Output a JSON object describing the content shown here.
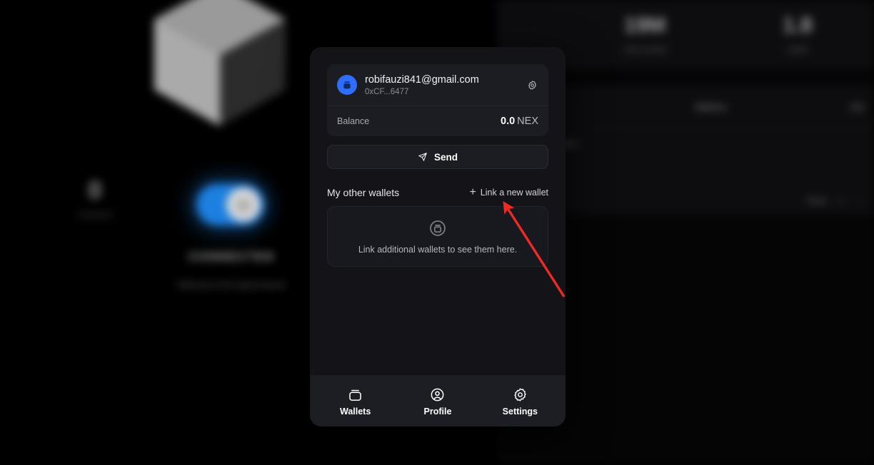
{
  "background": {
    "left": {
      "cube_icon": "cube-3d-icon",
      "counter_value": "0",
      "counter_label": "Connect",
      "toggle_state": "on",
      "toggle_icon": "power-icon",
      "connection_status": "CONNECTED",
      "connection_sub": "Welcome to the supercomputer"
    },
    "right": {
      "stats": [
        {
          "value": "·",
          "label": ""
        },
        {
          "value": "19M",
          "label": "units served"
        },
        {
          "value": "1.8",
          "label": "nodes"
        }
      ],
      "table": {
        "columns": [
          "",
          "Address",
          "Car"
        ],
        "empty_text": "Data coming soon...",
        "footer": {
          "rows_label": "Rows",
          "page": "1",
          "next": "›"
        }
      }
    }
  },
  "modal": {
    "account": {
      "avatar_icon": "wallet-avatar-icon",
      "email": "robifauzi841@gmail.com",
      "address": "0xCF...6477",
      "settings_icon": "gear-icon"
    },
    "balance": {
      "label": "Balance",
      "amount": "0.0",
      "unit": "NEX"
    },
    "send": {
      "icon": "send-paper-plane-icon",
      "label": "Send"
    },
    "other_wallets": {
      "title": "My other wallets",
      "link_new": {
        "icon": "plus-icon",
        "label": "Link a new wallet"
      },
      "empty": {
        "icon": "wallet-outline-icon",
        "text": "Link additional wallets to see them here."
      }
    },
    "nav": [
      {
        "icon": "wallet-outline-icon",
        "label": "Wallets",
        "active": true
      },
      {
        "icon": "user-circle-icon",
        "label": "Profile",
        "active": false
      },
      {
        "icon": "gear-icon",
        "label": "Settings",
        "active": false
      }
    ]
  },
  "annotation": {
    "type": "arrow",
    "color": "#ee2a22",
    "points_to": "link-a-new-wallet"
  },
  "colors": {
    "accent_blue": "#2f6dfb",
    "toggle_blue": "#1d7fe0",
    "modal_bg": "#131318",
    "card_bg": "#1c1d22",
    "nav_bg": "#1d1e23",
    "annotation_red": "#ee2a22"
  }
}
